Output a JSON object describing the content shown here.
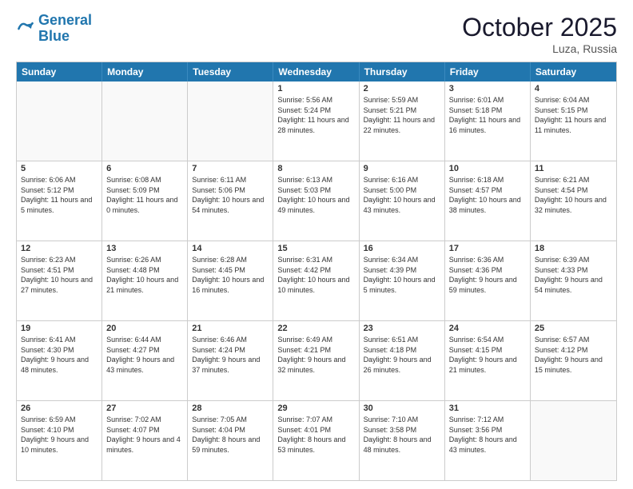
{
  "header": {
    "logo_general": "General",
    "logo_blue": "Blue",
    "month_title": "October 2025",
    "location": "Luza, Russia"
  },
  "days_of_week": [
    "Sunday",
    "Monday",
    "Tuesday",
    "Wednesday",
    "Thursday",
    "Friday",
    "Saturday"
  ],
  "rows": [
    [
      {
        "date": "",
        "info": "",
        "empty": true
      },
      {
        "date": "",
        "info": "",
        "empty": true
      },
      {
        "date": "",
        "info": "",
        "empty": true
      },
      {
        "date": "1",
        "info": "Sunrise: 5:56 AM\nSunset: 5:24 PM\nDaylight: 11 hours\nand 28 minutes."
      },
      {
        "date": "2",
        "info": "Sunrise: 5:59 AM\nSunset: 5:21 PM\nDaylight: 11 hours\nand 22 minutes."
      },
      {
        "date": "3",
        "info": "Sunrise: 6:01 AM\nSunset: 5:18 PM\nDaylight: 11 hours\nand 16 minutes."
      },
      {
        "date": "4",
        "info": "Sunrise: 6:04 AM\nSunset: 5:15 PM\nDaylight: 11 hours\nand 11 minutes."
      }
    ],
    [
      {
        "date": "5",
        "info": "Sunrise: 6:06 AM\nSunset: 5:12 PM\nDaylight: 11 hours\nand 5 minutes."
      },
      {
        "date": "6",
        "info": "Sunrise: 6:08 AM\nSunset: 5:09 PM\nDaylight: 11 hours\nand 0 minutes."
      },
      {
        "date": "7",
        "info": "Sunrise: 6:11 AM\nSunset: 5:06 PM\nDaylight: 10 hours\nand 54 minutes."
      },
      {
        "date": "8",
        "info": "Sunrise: 6:13 AM\nSunset: 5:03 PM\nDaylight: 10 hours\nand 49 minutes."
      },
      {
        "date": "9",
        "info": "Sunrise: 6:16 AM\nSunset: 5:00 PM\nDaylight: 10 hours\nand 43 minutes."
      },
      {
        "date": "10",
        "info": "Sunrise: 6:18 AM\nSunset: 4:57 PM\nDaylight: 10 hours\nand 38 minutes."
      },
      {
        "date": "11",
        "info": "Sunrise: 6:21 AM\nSunset: 4:54 PM\nDaylight: 10 hours\nand 32 minutes."
      }
    ],
    [
      {
        "date": "12",
        "info": "Sunrise: 6:23 AM\nSunset: 4:51 PM\nDaylight: 10 hours\nand 27 minutes."
      },
      {
        "date": "13",
        "info": "Sunrise: 6:26 AM\nSunset: 4:48 PM\nDaylight: 10 hours\nand 21 minutes."
      },
      {
        "date": "14",
        "info": "Sunrise: 6:28 AM\nSunset: 4:45 PM\nDaylight: 10 hours\nand 16 minutes."
      },
      {
        "date": "15",
        "info": "Sunrise: 6:31 AM\nSunset: 4:42 PM\nDaylight: 10 hours\nand 10 minutes."
      },
      {
        "date": "16",
        "info": "Sunrise: 6:34 AM\nSunset: 4:39 PM\nDaylight: 10 hours\nand 5 minutes."
      },
      {
        "date": "17",
        "info": "Sunrise: 6:36 AM\nSunset: 4:36 PM\nDaylight: 9 hours\nand 59 minutes."
      },
      {
        "date": "18",
        "info": "Sunrise: 6:39 AM\nSunset: 4:33 PM\nDaylight: 9 hours\nand 54 minutes."
      }
    ],
    [
      {
        "date": "19",
        "info": "Sunrise: 6:41 AM\nSunset: 4:30 PM\nDaylight: 9 hours\nand 48 minutes."
      },
      {
        "date": "20",
        "info": "Sunrise: 6:44 AM\nSunset: 4:27 PM\nDaylight: 9 hours\nand 43 minutes."
      },
      {
        "date": "21",
        "info": "Sunrise: 6:46 AM\nSunset: 4:24 PM\nDaylight: 9 hours\nand 37 minutes."
      },
      {
        "date": "22",
        "info": "Sunrise: 6:49 AM\nSunset: 4:21 PM\nDaylight: 9 hours\nand 32 minutes."
      },
      {
        "date": "23",
        "info": "Sunrise: 6:51 AM\nSunset: 4:18 PM\nDaylight: 9 hours\nand 26 minutes."
      },
      {
        "date": "24",
        "info": "Sunrise: 6:54 AM\nSunset: 4:15 PM\nDaylight: 9 hours\nand 21 minutes."
      },
      {
        "date": "25",
        "info": "Sunrise: 6:57 AM\nSunset: 4:12 PM\nDaylight: 9 hours\nand 15 minutes."
      }
    ],
    [
      {
        "date": "26",
        "info": "Sunrise: 6:59 AM\nSunset: 4:10 PM\nDaylight: 9 hours\nand 10 minutes."
      },
      {
        "date": "27",
        "info": "Sunrise: 7:02 AM\nSunset: 4:07 PM\nDaylight: 9 hours\nand 4 minutes."
      },
      {
        "date": "28",
        "info": "Sunrise: 7:05 AM\nSunset: 4:04 PM\nDaylight: 8 hours\nand 59 minutes."
      },
      {
        "date": "29",
        "info": "Sunrise: 7:07 AM\nSunset: 4:01 PM\nDaylight: 8 hours\nand 53 minutes."
      },
      {
        "date": "30",
        "info": "Sunrise: 7:10 AM\nSunset: 3:58 PM\nDaylight: 8 hours\nand 48 minutes."
      },
      {
        "date": "31",
        "info": "Sunrise: 7:12 AM\nSunset: 3:56 PM\nDaylight: 8 hours\nand 43 minutes."
      },
      {
        "date": "",
        "info": "",
        "empty": true
      }
    ]
  ]
}
